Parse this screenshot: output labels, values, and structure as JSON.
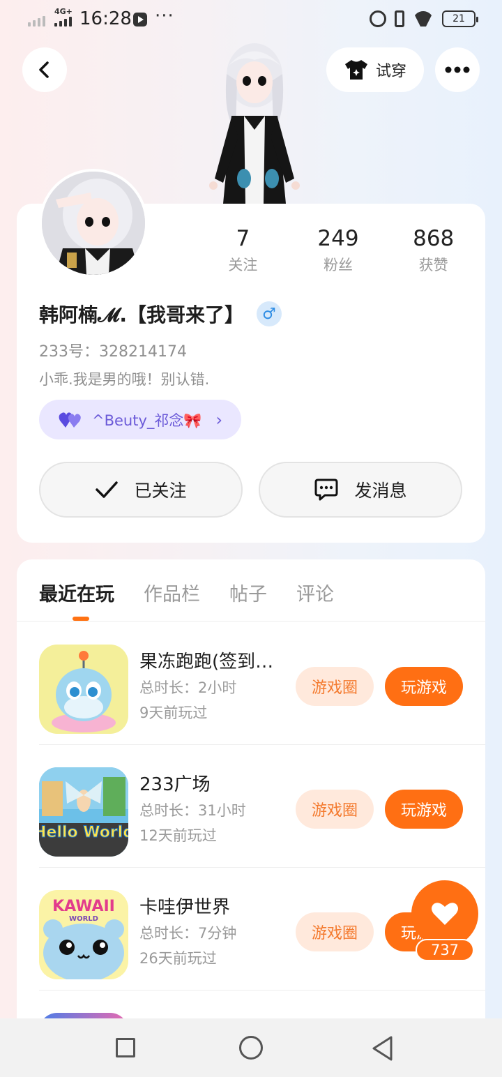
{
  "status_bar": {
    "network_tag": "4G+",
    "time": "16:28",
    "more_indicator": "···",
    "battery": "21"
  },
  "header": {
    "try_on_label": "试穿",
    "try_on_icon": "tshirt-icon",
    "back_icon": "chevron-left-icon",
    "more_icon": "more-dots-icon"
  },
  "profile": {
    "stats": [
      {
        "value": "7",
        "label": "关注"
      },
      {
        "value": "249",
        "label": "粉丝"
      },
      {
        "value": "868",
        "label": "获赞"
      }
    ],
    "name": "韩阿楠𝓜.【我哥来了】",
    "gender_icon": "male-icon",
    "gender_glyph": "♂",
    "uid": "233号：328214174",
    "bio": "小乖.我是男的哦！别认错.",
    "relation": {
      "icon": "double-heart-icon",
      "label": "^Beuty_祁念🎀"
    },
    "follow_label": "已关注",
    "message_label": "发消息"
  },
  "tabs": [
    {
      "label": "最近在玩",
      "active": true
    },
    {
      "label": "作品栏",
      "active": false
    },
    {
      "label": "帖子",
      "active": false
    },
    {
      "label": "评论",
      "active": false
    }
  ],
  "games": [
    {
      "title": "果冻跑跑(签到…",
      "duration": "总时长：2小时",
      "last_played": "9天前玩过",
      "circle_label": "游戏圈",
      "play_label": "玩游戏"
    },
    {
      "title": "233广场",
      "duration": "总时长：31小时",
      "last_played": "12天前玩过",
      "circle_label": "游戏圈",
      "play_label": "玩游戏",
      "icon_text": "Hello World"
    },
    {
      "title": "卡哇伊世界",
      "duration": "总时长：7分钟",
      "last_played": "26天前玩过",
      "circle_label": "游戏圈",
      "play_label": "玩游戏",
      "icon_text": "KAWAII",
      "icon_subtext": "WORLD"
    }
  ],
  "like": {
    "count": "737",
    "icon": "heart-icon"
  },
  "colors": {
    "accent": "#ff6f13",
    "accent_light": "#ffe9dc",
    "relation_bg": "#eae7ff",
    "relation_text": "#6b5ad8",
    "gender": "#2f8de4"
  }
}
